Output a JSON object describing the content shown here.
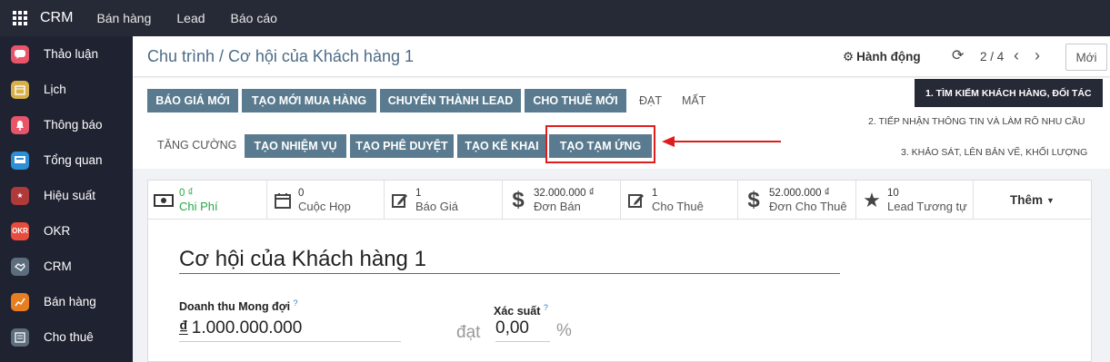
{
  "topnav": {
    "brand": "CRM",
    "menus": [
      "Bán hàng",
      "Lead",
      "Báo cáo"
    ]
  },
  "sidebar": {
    "items": [
      {
        "label": "Thảo luận",
        "icon": "chat-icon",
        "color": "#e8546a"
      },
      {
        "label": "Lịch",
        "icon": "calendar-icon",
        "color": "#e8b84a"
      },
      {
        "label": "Thông báo",
        "icon": "bell-icon",
        "color": "#e8546a"
      },
      {
        "label": "Tổng quan",
        "icon": "dashboard-icon",
        "color": "#2d8fd5"
      },
      {
        "label": "Hiệu suất",
        "icon": "star-icon",
        "color": "#c0392b"
      },
      {
        "label": "OKR",
        "icon": "okr-icon",
        "color": "#e74c3c",
        "glyph": "OKR"
      },
      {
        "label": "CRM",
        "icon": "handshake-icon",
        "color": "#5d6d7e"
      },
      {
        "label": "Bán hàng",
        "icon": "chart-icon",
        "color": "#e67e22"
      },
      {
        "label": "Cho thuê",
        "icon": "rental-icon",
        "color": "#5d6d7e"
      }
    ]
  },
  "control_panel": {
    "breadcrumb": "Chu trình / Cơ hội của Khách hàng 1",
    "action_label": "Hành động",
    "pager": "2 / 4",
    "new_label": "Mới"
  },
  "header": {
    "row1_buttons": [
      "Báo giá mới",
      "Tạo mới mua hàng",
      "Chuyển thành Lead",
      "Cho thuê mới"
    ],
    "row1_links": [
      "Đạt",
      "Mất"
    ],
    "row2_link": "Tăng cường",
    "row2_buttons": [
      "Tạo nhiệm vụ",
      "Tạo phê duyệt",
      "Tạo kê khai",
      "Tạo tạm ứng"
    ],
    "stages": [
      "1. Tìm kiếm khách hàng, đối tác",
      "2. Tiếp nhận thông tin và làm rõ nhu cầu",
      "3. Khảo sát, lên bản vẽ, khối lượng"
    ],
    "active_stage_index": 0,
    "highlight_color": "#e01d1d"
  },
  "stats": [
    {
      "value": "0 ₫",
      "label": "Chi Phí",
      "icon": "money-icon"
    },
    {
      "value": "0",
      "label": "Cuộc Họp",
      "icon": "calendar-icon"
    },
    {
      "value": "1",
      "label": "Báo Giá",
      "icon": "edit-icon"
    },
    {
      "value": "32.000.000 ₫",
      "label": "Đơn Bán",
      "icon": "dollar-icon"
    },
    {
      "value": "1",
      "label": "Cho Thuê",
      "icon": "edit-icon"
    },
    {
      "value": "52.000.000 ₫",
      "label": "Đơn Cho Thuê",
      "icon": "dollar-icon"
    },
    {
      "value": "10",
      "label": "Lead Tương tự",
      "icon": "star-icon"
    }
  ],
  "more_label": "Thêm",
  "form": {
    "title": "Cơ hội của Khách hàng 1",
    "revenue_label": "Doanh thu Mong đợi",
    "revenue_currency": "₫",
    "revenue_value": "1.000.000.000",
    "at_label": "đạt",
    "probability_label": "Xác suất",
    "probability_value": "0,00",
    "percent": "%"
  }
}
